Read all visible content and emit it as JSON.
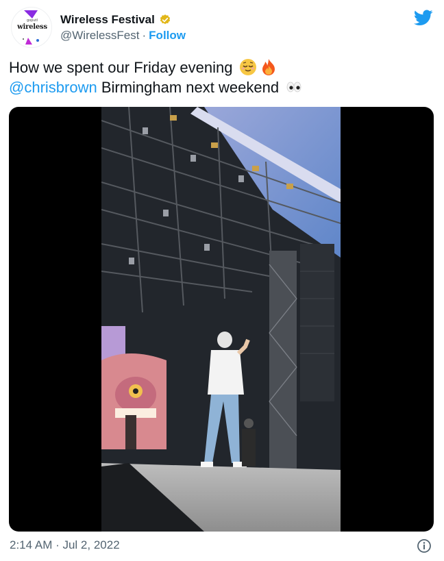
{
  "account": {
    "display_name": "Wireless Festival",
    "handle": "@WirelessFest",
    "separator": "·",
    "follow_label": "Follow",
    "avatar_logo_text": "wireless",
    "avatar_small_text": "goputl"
  },
  "tweet": {
    "text_line1": "How we spent our Friday evening",
    "mention": "@chrisbrown",
    "text_line2": "Birmingham next weekend",
    "emojis": [
      "relieved-face",
      "fire",
      "eyes"
    ]
  },
  "media": {
    "type": "video",
    "description_icons": [
      "stage-scene"
    ]
  },
  "footer": {
    "timestamp": "2:14 AM · Jul 2, 2022"
  },
  "colors": {
    "accent": "#1d9bf0",
    "secondary_text": "#536471",
    "verified": "#e2b719",
    "media_background": "#000000"
  }
}
